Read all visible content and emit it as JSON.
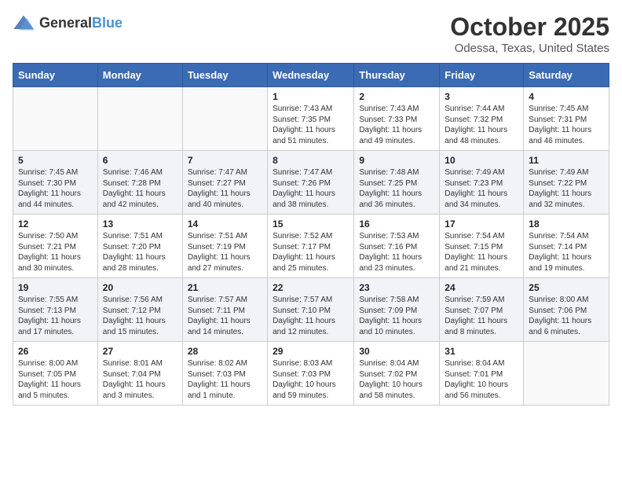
{
  "header": {
    "logo_general": "General",
    "logo_blue": "Blue",
    "month_title": "October 2025",
    "location": "Odessa, Texas, United States"
  },
  "days_of_week": [
    "Sunday",
    "Monday",
    "Tuesday",
    "Wednesday",
    "Thursday",
    "Friday",
    "Saturday"
  ],
  "weeks": [
    [
      {
        "day": "",
        "content": ""
      },
      {
        "day": "",
        "content": ""
      },
      {
        "day": "",
        "content": ""
      },
      {
        "day": "1",
        "content": "Sunrise: 7:43 AM\nSunset: 7:35 PM\nDaylight: 11 hours\nand 51 minutes."
      },
      {
        "day": "2",
        "content": "Sunrise: 7:43 AM\nSunset: 7:33 PM\nDaylight: 11 hours\nand 49 minutes."
      },
      {
        "day": "3",
        "content": "Sunrise: 7:44 AM\nSunset: 7:32 PM\nDaylight: 11 hours\nand 48 minutes."
      },
      {
        "day": "4",
        "content": "Sunrise: 7:45 AM\nSunset: 7:31 PM\nDaylight: 11 hours\nand 46 minutes."
      }
    ],
    [
      {
        "day": "5",
        "content": "Sunrise: 7:45 AM\nSunset: 7:30 PM\nDaylight: 11 hours\nand 44 minutes."
      },
      {
        "day": "6",
        "content": "Sunrise: 7:46 AM\nSunset: 7:28 PM\nDaylight: 11 hours\nand 42 minutes."
      },
      {
        "day": "7",
        "content": "Sunrise: 7:47 AM\nSunset: 7:27 PM\nDaylight: 11 hours\nand 40 minutes."
      },
      {
        "day": "8",
        "content": "Sunrise: 7:47 AM\nSunset: 7:26 PM\nDaylight: 11 hours\nand 38 minutes."
      },
      {
        "day": "9",
        "content": "Sunrise: 7:48 AM\nSunset: 7:25 PM\nDaylight: 11 hours\nand 36 minutes."
      },
      {
        "day": "10",
        "content": "Sunrise: 7:49 AM\nSunset: 7:23 PM\nDaylight: 11 hours\nand 34 minutes."
      },
      {
        "day": "11",
        "content": "Sunrise: 7:49 AM\nSunset: 7:22 PM\nDaylight: 11 hours\nand 32 minutes."
      }
    ],
    [
      {
        "day": "12",
        "content": "Sunrise: 7:50 AM\nSunset: 7:21 PM\nDaylight: 11 hours\nand 30 minutes."
      },
      {
        "day": "13",
        "content": "Sunrise: 7:51 AM\nSunset: 7:20 PM\nDaylight: 11 hours\nand 28 minutes."
      },
      {
        "day": "14",
        "content": "Sunrise: 7:51 AM\nSunset: 7:19 PM\nDaylight: 11 hours\nand 27 minutes."
      },
      {
        "day": "15",
        "content": "Sunrise: 7:52 AM\nSunset: 7:17 PM\nDaylight: 11 hours\nand 25 minutes."
      },
      {
        "day": "16",
        "content": "Sunrise: 7:53 AM\nSunset: 7:16 PM\nDaylight: 11 hours\nand 23 minutes."
      },
      {
        "day": "17",
        "content": "Sunrise: 7:54 AM\nSunset: 7:15 PM\nDaylight: 11 hours\nand 21 minutes."
      },
      {
        "day": "18",
        "content": "Sunrise: 7:54 AM\nSunset: 7:14 PM\nDaylight: 11 hours\nand 19 minutes."
      }
    ],
    [
      {
        "day": "19",
        "content": "Sunrise: 7:55 AM\nSunset: 7:13 PM\nDaylight: 11 hours\nand 17 minutes."
      },
      {
        "day": "20",
        "content": "Sunrise: 7:56 AM\nSunset: 7:12 PM\nDaylight: 11 hours\nand 15 minutes."
      },
      {
        "day": "21",
        "content": "Sunrise: 7:57 AM\nSunset: 7:11 PM\nDaylight: 11 hours\nand 14 minutes."
      },
      {
        "day": "22",
        "content": "Sunrise: 7:57 AM\nSunset: 7:10 PM\nDaylight: 11 hours\nand 12 minutes."
      },
      {
        "day": "23",
        "content": "Sunrise: 7:58 AM\nSunset: 7:09 PM\nDaylight: 11 hours\nand 10 minutes."
      },
      {
        "day": "24",
        "content": "Sunrise: 7:59 AM\nSunset: 7:07 PM\nDaylight: 11 hours\nand 8 minutes."
      },
      {
        "day": "25",
        "content": "Sunrise: 8:00 AM\nSunset: 7:06 PM\nDaylight: 11 hours\nand 6 minutes."
      }
    ],
    [
      {
        "day": "26",
        "content": "Sunrise: 8:00 AM\nSunset: 7:05 PM\nDaylight: 11 hours\nand 5 minutes."
      },
      {
        "day": "27",
        "content": "Sunrise: 8:01 AM\nSunset: 7:04 PM\nDaylight: 11 hours\nand 3 minutes."
      },
      {
        "day": "28",
        "content": "Sunrise: 8:02 AM\nSunset: 7:03 PM\nDaylight: 11 hours\nand 1 minute."
      },
      {
        "day": "29",
        "content": "Sunrise: 8:03 AM\nSunset: 7:03 PM\nDaylight: 10 hours\nand 59 minutes."
      },
      {
        "day": "30",
        "content": "Sunrise: 8:04 AM\nSunset: 7:02 PM\nDaylight: 10 hours\nand 58 minutes."
      },
      {
        "day": "31",
        "content": "Sunrise: 8:04 AM\nSunset: 7:01 PM\nDaylight: 10 hours\nand 56 minutes."
      },
      {
        "day": "",
        "content": ""
      }
    ]
  ]
}
